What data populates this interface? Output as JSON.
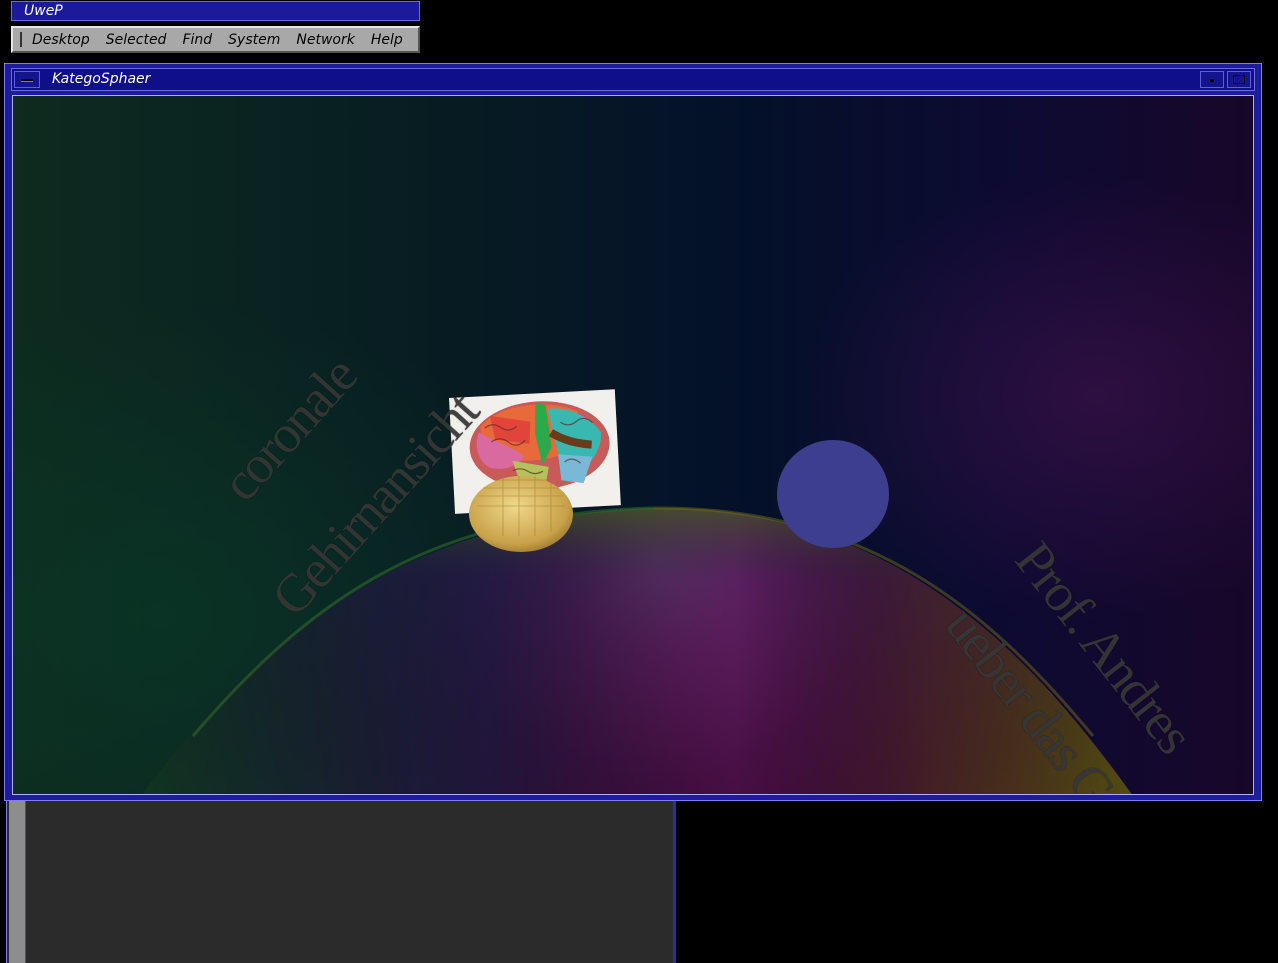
{
  "toolchest": {
    "title": "UweP",
    "menu": [
      "Desktop",
      "Selected",
      "Find",
      "System",
      "Network",
      "Help"
    ]
  },
  "window": {
    "title": "KategoSphaer"
  },
  "scene": {
    "label_left_1": "coronale",
    "label_left_2": "Gehirnansicht",
    "label_right_1": "Prof. Andres",
    "label_right_2": "ueber das Gehirn"
  },
  "colors": {
    "title_bar": "#1a1a9a",
    "menu_bar": "#a8a8a8",
    "sphere_blue": "#3e3e8e",
    "panel_bg": "#2b2b2b"
  }
}
